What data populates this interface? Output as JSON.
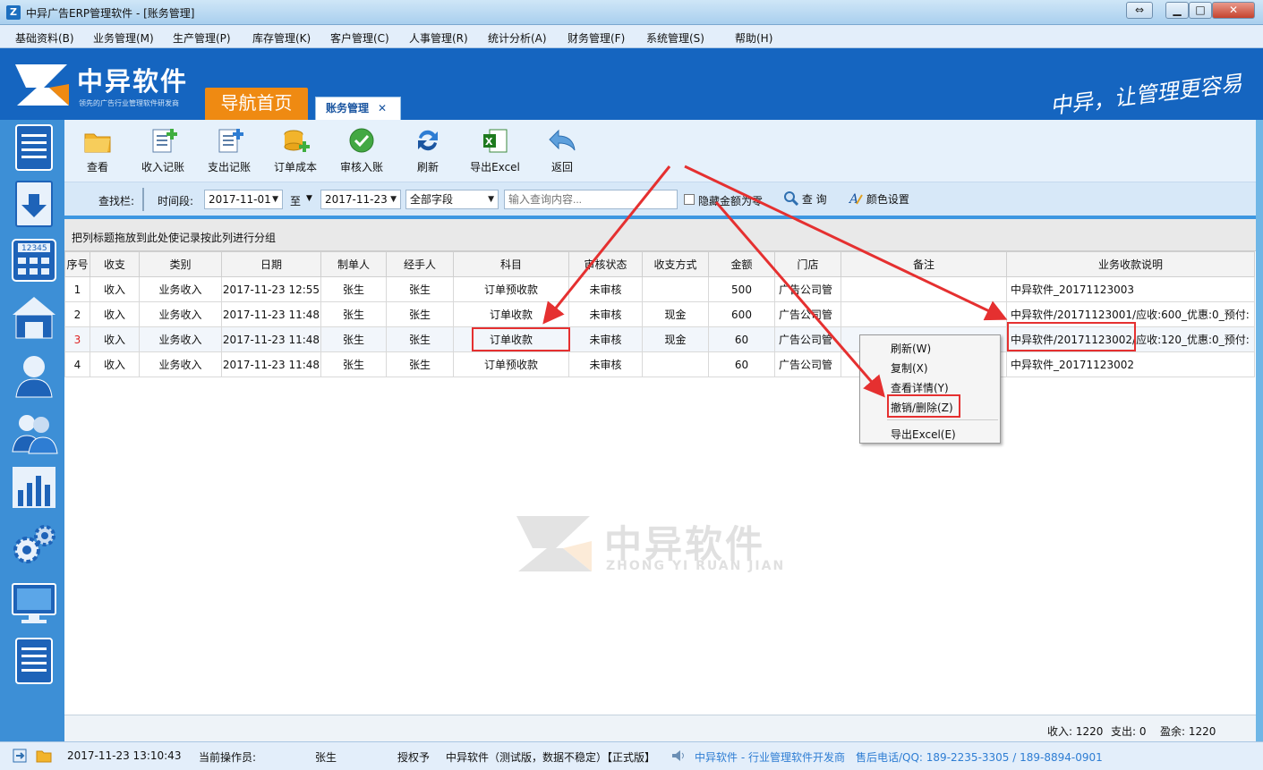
{
  "window": {
    "icon": "Z",
    "title": "中异广告ERP管理软件 - [账务管理]",
    "restore_btn": "⇔",
    "min_btn": "▁",
    "max_btn": "□",
    "close_btn": "✕"
  },
  "menu": [
    "基础资料(B)",
    "业务管理(M)",
    "生产管理(P)",
    "库存管理(K)",
    "客户管理(C)",
    "人事管理(R)",
    "统计分析(A)",
    "财务管理(F)",
    "系统管理(S)",
    "帮助(H)"
  ],
  "banner": {
    "brand": "中异软件",
    "brand_sub": "领先的广告行业管理软件研发商",
    "slogan": "中异，让管理更容易",
    "tab_home": "导航首页",
    "tab_active": "账务管理",
    "tab_close": "✕"
  },
  "toolbar": [
    "查看",
    "收入记账",
    "支出记账",
    "订单成本",
    "审核入账",
    "刷新",
    "导出Excel",
    "返回"
  ],
  "search": {
    "label": "查找栏:",
    "period_label": "时间段:",
    "date_from": "2017-11-01",
    "to_label": "至",
    "date_to": "2017-11-23",
    "field": "全部字段",
    "placeholder": "输入查询内容...",
    "hide_zero": "隐藏金额为零",
    "query": "查 询",
    "color_settings": "颜色设置"
  },
  "group_hint": "把列标题拖放到此处使记录按此列进行分组",
  "table": {
    "columns": [
      "序号",
      "收支",
      "类别",
      "日期",
      "制单人",
      "经手人",
      "科目",
      "审核状态",
      "收支方式",
      "金额",
      "门店",
      "备注",
      "业务收款说明"
    ],
    "rows": [
      [
        "1",
        "收入",
        "业务收入",
        "2017-11-23 12:55",
        "张生",
        "张生",
        "订单预收款",
        "未审核",
        "",
        "500",
        "广告公司管",
        "",
        "中异软件_20171123003"
      ],
      [
        "2",
        "收入",
        "业务收入",
        "2017-11-23 11:48",
        "张生",
        "张生",
        "订单收款",
        "未审核",
        "现金",
        "600",
        "广告公司管",
        "",
        "中异软件/20171123001/应收:600_优惠:0_预付:"
      ],
      [
        "3",
        "收入",
        "业务收入",
        "2017-11-23 11:48",
        "张生",
        "张生",
        "订单收款",
        "未审核",
        "现金",
        "60",
        "广告公司管",
        "",
        "中异软件/20171123002/应收:120_优惠:0_预付:"
      ],
      [
        "4",
        "收入",
        "业务收入",
        "2017-11-23 11:48",
        "张生",
        "张生",
        "订单预收款",
        "未审核",
        "",
        "60",
        "广告公司管",
        "",
        "中异软件_20171123002"
      ]
    ]
  },
  "context_menu": [
    "刷新(W)",
    "复制(X)",
    "查看详情(Y)",
    "撤销/删除(Z)",
    "导出Excel(E)"
  ],
  "summary": {
    "income": "收入: 1220",
    "expense": "支出: 0",
    "balance": "盈余: 1220"
  },
  "status": {
    "datetime": "2017-11-23 13:10:43",
    "operator_label": "当前操作员:",
    "operator": "张生",
    "license_label": "授权予",
    "license": "中异软件（测试版，数据不稳定）【正式版】",
    "vendor": "中异软件 - 行业管理软件开发商",
    "support": "售后电话/QQ: 189-2235-3305 / 189-8894-0901"
  },
  "watermark": {
    "cn": "中异软件",
    "en": "ZHONG YI RUAN JIAN"
  },
  "colors": {
    "brand_blue": "#1565c0",
    "accent_orange": "#ef8a12",
    "highlight_red": "#e53030"
  }
}
